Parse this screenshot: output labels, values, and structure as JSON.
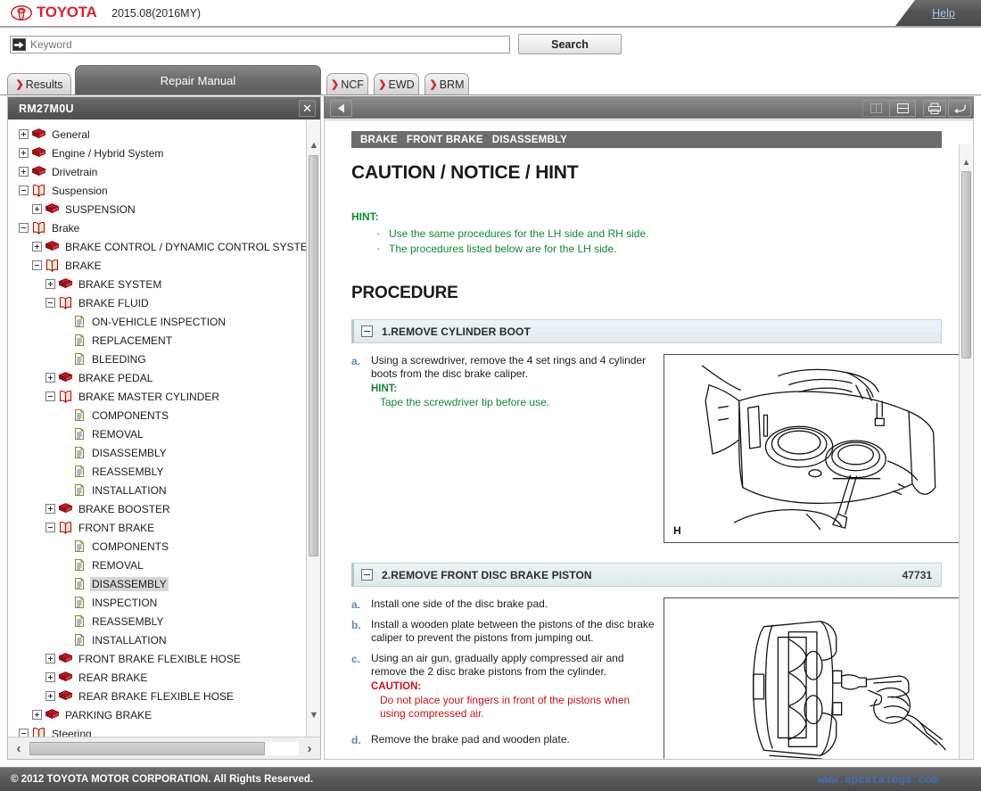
{
  "brand": {
    "name": "TOYOTA",
    "logo_icon": "toyota-ellipse-logo",
    "model_year": "2015.08(2016MY)",
    "help_label": "Help"
  },
  "search": {
    "placeholder": "Keyword",
    "value": "",
    "icon": "keyword-arrow-icon",
    "button_label": "Search"
  },
  "tabs": [
    {
      "label": "Results",
      "chevron": "❯",
      "active": false
    },
    {
      "label": "Repair Manual",
      "chevron": "",
      "active": true
    },
    {
      "label": "NCF",
      "chevron": "❯",
      "active": false
    },
    {
      "label": "EWD",
      "chevron": "❯",
      "active": false
    },
    {
      "label": "BRM",
      "chevron": "❯",
      "active": false
    }
  ],
  "left_panel": {
    "title": "RM27M0U",
    "close_icon": "close-icon",
    "scroll_up_icon": "chevron-up-icon",
    "scroll_down_icon": "chevron-down-icon",
    "h_left_icon": "chevron-left-icon",
    "h_right_icon": "chevron-right-icon",
    "tree": [
      {
        "label": "General",
        "level": 0,
        "toggle": "plus",
        "icon": "closed-book-icon",
        "selected": false
      },
      {
        "label": "Engine / Hybrid System",
        "level": 0,
        "toggle": "plus",
        "icon": "closed-book-icon",
        "selected": false
      },
      {
        "label": "Drivetrain",
        "level": 0,
        "toggle": "plus",
        "icon": "closed-book-icon",
        "selected": false
      },
      {
        "label": "Suspension",
        "level": 0,
        "toggle": "minus",
        "icon": "open-book-icon",
        "selected": false
      },
      {
        "label": "SUSPENSION",
        "level": 1,
        "toggle": "plus",
        "icon": "closed-book-icon",
        "selected": false
      },
      {
        "label": "Brake",
        "level": 0,
        "toggle": "minus",
        "icon": "open-book-icon",
        "selected": false
      },
      {
        "label": "BRAKE CONTROL / DYNAMIC CONTROL SYSTEMS",
        "level": 1,
        "toggle": "plus",
        "icon": "closed-book-icon",
        "selected": false
      },
      {
        "label": "BRAKE",
        "level": 1,
        "toggle": "minus",
        "icon": "open-book-icon",
        "selected": false
      },
      {
        "label": "BRAKE SYSTEM",
        "level": 2,
        "toggle": "plus",
        "icon": "closed-book-icon",
        "selected": false
      },
      {
        "label": "BRAKE FLUID",
        "level": 2,
        "toggle": "minus",
        "icon": "open-book-icon",
        "selected": false
      },
      {
        "label": "ON-VEHICLE INSPECTION",
        "level": 3,
        "toggle": "none",
        "icon": "page-icon",
        "selected": false
      },
      {
        "label": "REPLACEMENT",
        "level": 3,
        "toggle": "none",
        "icon": "page-icon",
        "selected": false
      },
      {
        "label": "BLEEDING",
        "level": 3,
        "toggle": "none",
        "icon": "page-icon",
        "selected": false
      },
      {
        "label": "BRAKE PEDAL",
        "level": 2,
        "toggle": "plus",
        "icon": "closed-book-icon",
        "selected": false
      },
      {
        "label": "BRAKE MASTER CYLINDER",
        "level": 2,
        "toggle": "minus",
        "icon": "open-book-icon",
        "selected": false
      },
      {
        "label": "COMPONENTS",
        "level": 3,
        "toggle": "none",
        "icon": "page-icon",
        "selected": false
      },
      {
        "label": "REMOVAL",
        "level": 3,
        "toggle": "none",
        "icon": "page-icon",
        "selected": false
      },
      {
        "label": "DISASSEMBLY",
        "level": 3,
        "toggle": "none",
        "icon": "page-icon",
        "selected": false
      },
      {
        "label": "REASSEMBLY",
        "level": 3,
        "toggle": "none",
        "icon": "page-icon",
        "selected": false
      },
      {
        "label": "INSTALLATION",
        "level": 3,
        "toggle": "none",
        "icon": "page-icon",
        "selected": false
      },
      {
        "label": "BRAKE BOOSTER",
        "level": 2,
        "toggle": "plus",
        "icon": "closed-book-icon",
        "selected": false
      },
      {
        "label": "FRONT BRAKE",
        "level": 2,
        "toggle": "minus",
        "icon": "open-book-icon",
        "selected": false
      },
      {
        "label": "COMPONENTS",
        "level": 3,
        "toggle": "none",
        "icon": "page-icon",
        "selected": false
      },
      {
        "label": "REMOVAL",
        "level": 3,
        "toggle": "none",
        "icon": "page-icon",
        "selected": false
      },
      {
        "label": "DISASSEMBLY",
        "level": 3,
        "toggle": "none",
        "icon": "page-icon",
        "selected": true
      },
      {
        "label": "INSPECTION",
        "level": 3,
        "toggle": "none",
        "icon": "page-icon",
        "selected": false
      },
      {
        "label": "REASSEMBLY",
        "level": 3,
        "toggle": "none",
        "icon": "page-icon",
        "selected": false
      },
      {
        "label": "INSTALLATION",
        "level": 3,
        "toggle": "none",
        "icon": "page-icon",
        "selected": false
      },
      {
        "label": "FRONT BRAKE FLEXIBLE HOSE",
        "level": 2,
        "toggle": "plus",
        "icon": "closed-book-icon",
        "selected": false
      },
      {
        "label": "REAR BRAKE",
        "level": 2,
        "toggle": "plus",
        "icon": "closed-book-icon",
        "selected": false
      },
      {
        "label": "REAR BRAKE FLEXIBLE HOSE",
        "level": 2,
        "toggle": "plus",
        "icon": "closed-book-icon",
        "selected": false
      },
      {
        "label": "PARKING BRAKE",
        "level": 1,
        "toggle": "plus",
        "icon": "closed-book-icon",
        "selected": false
      },
      {
        "label": "Steering",
        "level": 0,
        "toggle": "minus",
        "icon": "open-book-icon",
        "selected": false
      }
    ]
  },
  "right_panel": {
    "toolbar": {
      "back_icon": "back-arrow-icon",
      "grid_one_icon": "single-pane-icon",
      "grid_two_icon": "split-pane-icon",
      "print_icon": "print-icon",
      "exit_icon": "exit-arrow-icon"
    },
    "breadcrumb": [
      "BRAKE",
      "FRONT BRAKE",
      "DISASSEMBLY"
    ],
    "heading": "CAUTION / NOTICE / HINT",
    "hint_label": "HINT:",
    "hint_items": [
      "Use the same procedures for the LH side and RH side.",
      "The procedures listed below are for the LH side."
    ],
    "procedure_heading": "PROCEDURE",
    "steps": [
      {
        "title": "1.REMOVE CYLINDER BOOT",
        "code": "",
        "paragraphs": [
          {
            "marker": "a.",
            "text": "Using a screwdriver, remove the 4 set rings and 4 cylinder boots from the disc brake caliper.",
            "note_label": "HINT:",
            "note_text": "Tape the screwdriver tip before use.",
            "note_type": "hint"
          }
        ],
        "figure": {
          "name": "disc-brake-caliper-cylinder-boot-figure",
          "tag": "H"
        }
      },
      {
        "title": "2.REMOVE FRONT DISC BRAKE PISTON",
        "code": "47731",
        "paragraphs": [
          {
            "marker": "a.",
            "text": "Install one side of the disc brake pad.",
            "note_label": "",
            "note_text": "",
            "note_type": ""
          },
          {
            "marker": "b.",
            "text": "Install a wooden plate between the pistons of the disc brake caliper to prevent the pistons from jumping out.",
            "note_label": "",
            "note_text": "",
            "note_type": ""
          },
          {
            "marker": "c.",
            "text": "Using an air gun, gradually apply compressed air and remove the 2 disc brake pistons from the cylinder.",
            "note_label": "CAUTION:",
            "note_text": "Do not place your fingers in front of the pistons when using compressed air.",
            "note_type": "caution"
          },
          {
            "marker": "d.",
            "text": "Remove the brake pad and wooden plate.",
            "note_label": "",
            "note_text": "",
            "note_type": ""
          }
        ],
        "figure": {
          "name": "air-gun-piston-removal-figure",
          "tag": ""
        }
      }
    ]
  },
  "footer": {
    "copyright": "© 2012 TOYOTA MOTOR CORPORATION. All Rights Reserved.",
    "site": "www.epcatalogs.com"
  },
  "colors": {
    "brand_red": "#d8222e",
    "hint_green": "#0f8a36",
    "caution_red": "#cc1111",
    "marker_blue": "#5e87b0",
    "chrome_gray": "#5a5a5a",
    "footer_link": "#3e6fb5"
  }
}
